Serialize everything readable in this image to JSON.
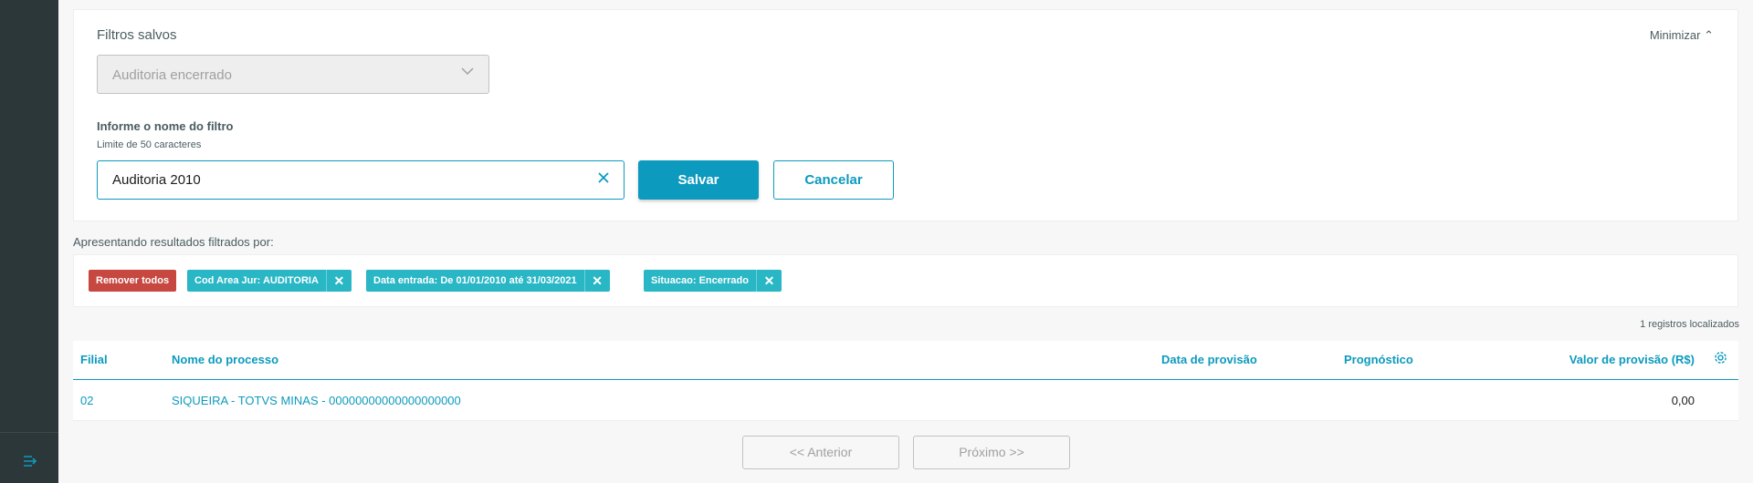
{
  "sidebar": {
    "collapse_icon": "menu-collapse-icon"
  },
  "saved_filters": {
    "title": "Filtros salvos",
    "minimize_label": "Minimizar",
    "selected": "Auditoria encerrado"
  },
  "filter_name": {
    "label": "Informe o nome do filtro",
    "help": "Limite de 50 caracteres",
    "value": "Auditoria 2010",
    "save_label": "Salvar",
    "cancel_label": "Cancelar"
  },
  "active_filters": {
    "label": "Apresentando resultados filtrados por:",
    "remove_all": "Remover todos",
    "chips": [
      "Cod Area Jur: AUDITORIA",
      "Data entrada: De 01/01/2010 até 31/03/2021",
      "Situacao: Encerrado"
    ]
  },
  "records_count": "1 registros localizados",
  "table": {
    "columns": [
      "Filial",
      "Nome do processo",
      "Data de provisão",
      "Prognóstico",
      "Valor de provisão (R$)"
    ],
    "rows": [
      {
        "filial": "02",
        "nome": "SIQUEIRA - TOTVS MINAS - 00000000000000000000",
        "data": "",
        "prognostico": "",
        "valor": "0,00"
      }
    ]
  },
  "pagination": {
    "prev_label": "<< Anterior",
    "next_label": "Próximo >>"
  },
  "colors": {
    "primary": "#0c9abe",
    "danger": "#c64840",
    "chip": "#29b6c5",
    "sidebar": "#2c3739"
  }
}
